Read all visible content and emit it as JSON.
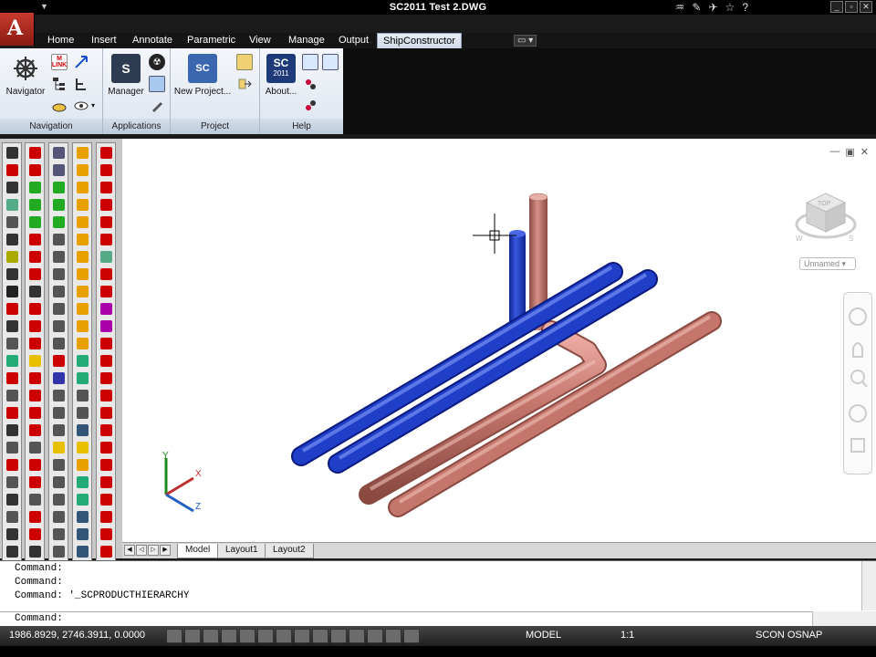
{
  "window": {
    "title": "SC2011   Test 2.DWG"
  },
  "ribbon": {
    "tabs": [
      "Home",
      "Insert",
      "Annotate",
      "Parametric",
      "View",
      "Manage",
      "Output",
      "ShipConstructor"
    ],
    "active_tab": "ShipConstructor",
    "panels": {
      "navigation": {
        "title": "Navigation",
        "navigator_label": "Navigator",
        "mlink_text": "M LINK"
      },
      "applications": {
        "title": "Applications",
        "manager_label": "Manager"
      },
      "project": {
        "title": "Project",
        "new_project_label": "New Project..."
      },
      "help": {
        "title": "Help",
        "about_label": "About...",
        "sc_logo_top": "SC",
        "sc_logo_year": "2011"
      }
    }
  },
  "viewport": {
    "unnamed_label": "Unnamed",
    "viewcube": {
      "face_label": "TOP",
      "compass_w": "W",
      "compass_s": "S"
    },
    "ucs": {
      "x": "X",
      "y": "Y",
      "z": "Z"
    }
  },
  "layout_tabs": [
    "Model",
    "Layout1",
    "Layout2"
  ],
  "command": {
    "history": [
      "Command:",
      "Command:",
      "Command: '_SCPRODUCTHIERARCHY"
    ],
    "prompt": "Command:"
  },
  "status": {
    "coords": "1986.8929, 2746.3911, 0.0000",
    "model_label": "MODEL",
    "scale_label": "1:1",
    "scon_label": "SCON OSNAP"
  },
  "colors": {
    "blue_pipe": "#1f3fc8",
    "red_pipe": "#c4766c",
    "accent_red": "#c83a2e"
  }
}
